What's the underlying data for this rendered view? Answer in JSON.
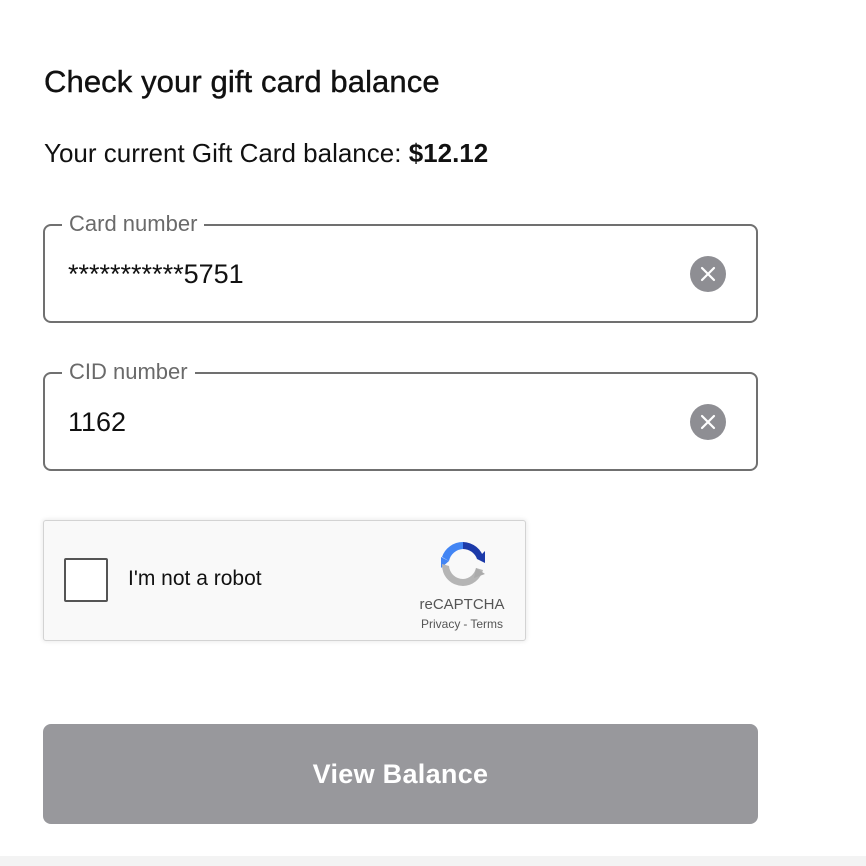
{
  "header": {
    "title": "Check your gift card balance"
  },
  "balance": {
    "label": "Your current Gift Card balance: ",
    "amount": "$12.12"
  },
  "card_field": {
    "label": "Card number",
    "value": "***********5751"
  },
  "cid_field": {
    "label": "CID number",
    "value": "1162"
  },
  "recaptcha": {
    "checkbox_label": "I'm not a robot",
    "brand": "reCAPTCHA",
    "privacy": "Privacy",
    "separator": "-",
    "terms": "Terms",
    "checked": false
  },
  "actions": {
    "view_balance_label": "View Balance",
    "disabled": true
  },
  "icons": {
    "clear": "clear-circle-icon",
    "recaptcha": "recaptcha-logo-icon"
  },
  "colors": {
    "button_disabled": "#98989c",
    "clear_icon_bg": "#8e8e93",
    "field_border": "#707070"
  }
}
